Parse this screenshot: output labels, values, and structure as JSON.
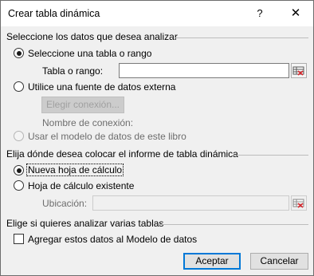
{
  "dialog": {
    "title": "Crear tabla dinámica",
    "help_label": "?",
    "close_label": "✕"
  },
  "section1": {
    "title": "Seleccione los datos que desea analizar",
    "option_table": "Seleccione una tabla o rango",
    "table_label": "Tabla o rango:",
    "table_value": "",
    "option_external": "Utilice una fuente de datos externa",
    "choose_connection": "Elegir conexión...",
    "connection_name": "Nombre de conexión:",
    "option_datamodel": "Usar el modelo de datos de este libro"
  },
  "section2": {
    "title": "Elija dónde desea colocar el informe de tabla dinámica",
    "option_new": "Nueva hoja de cálculo",
    "option_existing": "Hoja de cálculo existente",
    "location_label": "Ubicación:",
    "location_value": ""
  },
  "section3": {
    "title": "Elige si quieres analizar varias tablas",
    "add_to_model": "Agregar estos datos al Modelo de datos"
  },
  "buttons": {
    "accept": "Aceptar",
    "cancel": "Cancelar"
  },
  "state": {
    "selected_source": "table",
    "selected_destination": "new",
    "add_to_model_checked": false
  },
  "icons": {
    "range_selector": "range-selector-icon"
  }
}
